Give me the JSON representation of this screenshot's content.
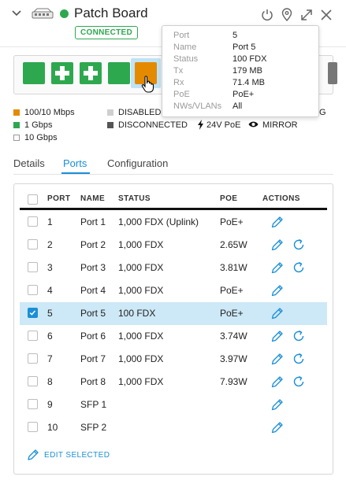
{
  "header": {
    "title": "Patch Board",
    "badge": "CONNECTED"
  },
  "colors": {
    "green": "#2ea84f",
    "orange": "#e48a00",
    "accent": "#1a8fd6",
    "selected_row": "#cde8f6"
  },
  "ports_strip": [
    {
      "color": "#2ea84f",
      "icon": "none"
    },
    {
      "color": "#2ea84f",
      "icon": "plus-icon"
    },
    {
      "color": "#2ea84f",
      "icon": "plus-icon"
    },
    {
      "color": "#2ea84f",
      "icon": "none"
    },
    {
      "color": "#e48a00",
      "icon": "none",
      "selected": true
    }
  ],
  "legend": {
    "speed_100": "100/10 Mbps",
    "speed_1g": "1 Gbps",
    "speed_10g": "10 Gbps",
    "disabled": "DISABLED",
    "disconnected": "DISCONNECTED",
    "poe24": "24V PoE",
    "mirror": "MIRROR",
    "lag_partial": "G"
  },
  "tooltip": {
    "rows": [
      {
        "key": "Port",
        "value": "5"
      },
      {
        "key": "Name",
        "value": "Port 5"
      },
      {
        "key": "Status",
        "value": "100 FDX"
      },
      {
        "key": "Tx",
        "value": "179 MB"
      },
      {
        "key": "Rx",
        "value": "71.4 MB"
      },
      {
        "key": "PoE",
        "value": "PoE+"
      },
      {
        "key": "NWs/VLANs",
        "value": "All"
      }
    ]
  },
  "tabs": [
    "Details",
    "Ports",
    "Configuration"
  ],
  "table": {
    "headers": {
      "port": "PORT",
      "name": "NAME",
      "status": "STATUS",
      "poe": "POE",
      "actions": "ACTIONS"
    },
    "rows": [
      {
        "port": "1",
        "name": "Port 1",
        "status": "1,000 FDX (Uplink)",
        "poe": "PoE+",
        "power_cycle": false,
        "checked": false
      },
      {
        "port": "2",
        "name": "Port 2",
        "status": "1,000 FDX",
        "poe": "2.65W",
        "power_cycle": true,
        "checked": false
      },
      {
        "port": "3",
        "name": "Port 3",
        "status": "1,000 FDX",
        "poe": "3.81W",
        "power_cycle": true,
        "checked": false
      },
      {
        "port": "4",
        "name": "Port 4",
        "status": "1,000 FDX",
        "poe": "PoE+",
        "power_cycle": false,
        "checked": false
      },
      {
        "port": "5",
        "name": "Port 5",
        "status": "100 FDX",
        "poe": "PoE+",
        "power_cycle": false,
        "checked": true
      },
      {
        "port": "6",
        "name": "Port 6",
        "status": "1,000 FDX",
        "poe": "3.74W",
        "power_cycle": true,
        "checked": false
      },
      {
        "port": "7",
        "name": "Port 7",
        "status": "1,000 FDX",
        "poe": "3.97W",
        "power_cycle": true,
        "checked": false
      },
      {
        "port": "8",
        "name": "Port 8",
        "status": "1,000 FDX",
        "poe": "7.93W",
        "power_cycle": true,
        "checked": false
      },
      {
        "port": "9",
        "name": "SFP 1",
        "status": "",
        "poe": "",
        "power_cycle": false,
        "checked": false
      },
      {
        "port": "10",
        "name": "SFP 2",
        "status": "",
        "poe": "",
        "power_cycle": false,
        "checked": false
      }
    ]
  },
  "edit_selected": "EDIT SELECTED"
}
